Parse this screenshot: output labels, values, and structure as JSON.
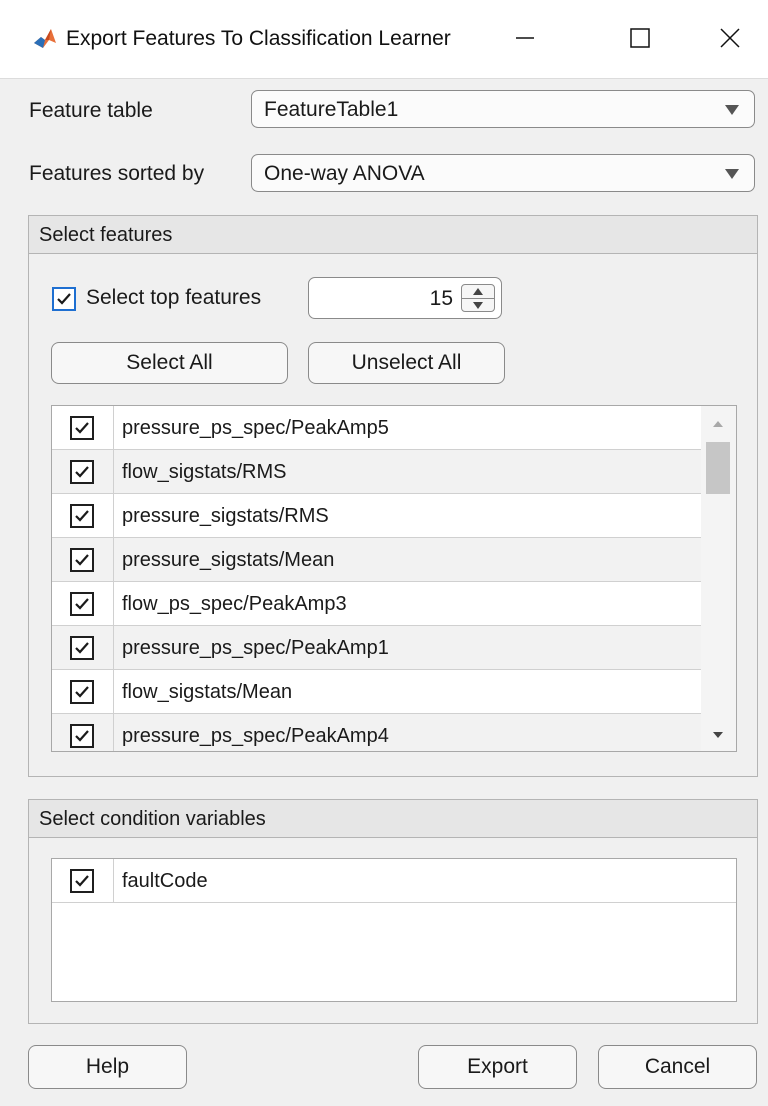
{
  "window": {
    "title": "Export Features To Classification Learner"
  },
  "form": {
    "feature_table_label": "Feature table",
    "feature_table_value": "FeatureTable1",
    "sorted_by_label": "Features sorted by",
    "sorted_by_value": "One-way ANOVA"
  },
  "select_features": {
    "title": "Select features",
    "top_features_label": "Select top features",
    "top_features_checked": true,
    "top_features_count": "15",
    "select_all_label": "Select All",
    "unselect_all_label": "Unselect All",
    "rows": [
      {
        "label": "pressure_ps_spec/PeakAmp5",
        "checked": true
      },
      {
        "label": "flow_sigstats/RMS",
        "checked": true
      },
      {
        "label": "pressure_sigstats/RMS",
        "checked": true
      },
      {
        "label": "pressure_sigstats/Mean",
        "checked": true
      },
      {
        "label": "flow_ps_spec/PeakAmp3",
        "checked": true
      },
      {
        "label": "pressure_ps_spec/PeakAmp1",
        "checked": true
      },
      {
        "label": "flow_sigstats/Mean",
        "checked": true
      },
      {
        "label": "pressure_ps_spec/PeakAmp4",
        "checked": true
      }
    ]
  },
  "condition_variables": {
    "title": "Select condition variables",
    "rows": [
      {
        "label": "faultCode",
        "checked": true
      }
    ]
  },
  "footer": {
    "help_label": "Help",
    "export_label": "Export",
    "cancel_label": "Cancel"
  },
  "colors": {
    "accent": "#1e6fd1",
    "background": "#f0f0f0",
    "panel_header": "#e6e6e6"
  }
}
